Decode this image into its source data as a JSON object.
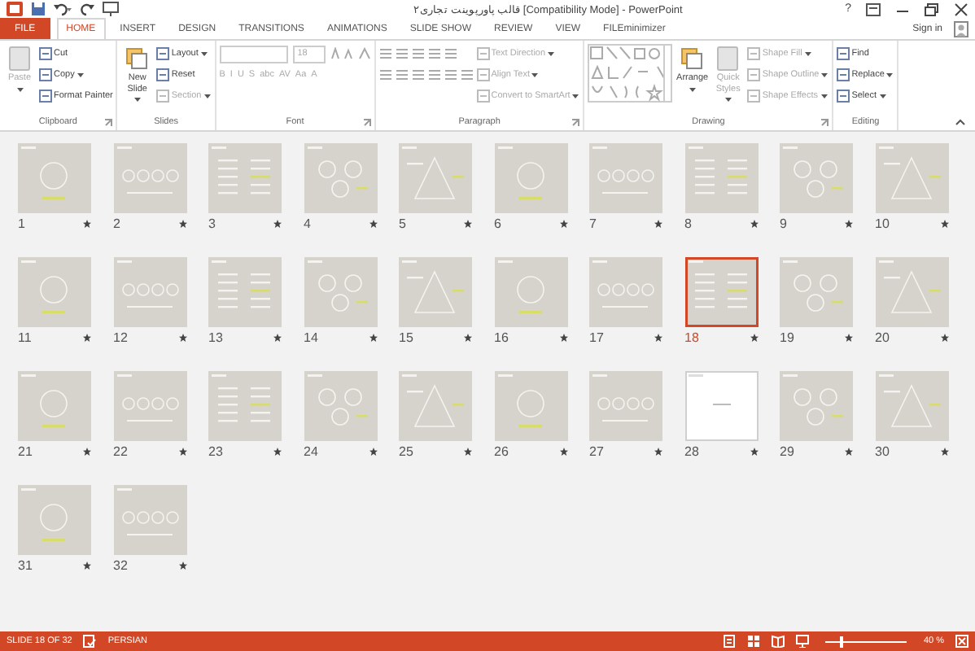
{
  "window": {
    "title": "قالب پاورپوینت تجاری۲ [Compatibility Mode] - PowerPoint",
    "help": "?"
  },
  "tabs": [
    {
      "label": "FILE",
      "kind": "file",
      "selected": false
    },
    {
      "label": "HOME",
      "kind": "tab",
      "selected": true
    },
    {
      "label": "INSERT",
      "kind": "tab",
      "selected": false
    },
    {
      "label": "DESIGN",
      "kind": "tab",
      "selected": false
    },
    {
      "label": "TRANSITIONS",
      "kind": "tab",
      "selected": false
    },
    {
      "label": "ANIMATIONS",
      "kind": "tab",
      "selected": false
    },
    {
      "label": "SLIDE SHOW",
      "kind": "tab",
      "selected": false
    },
    {
      "label": "REVIEW",
      "kind": "tab",
      "selected": false
    },
    {
      "label": "VIEW",
      "kind": "tab",
      "selected": false
    },
    {
      "label": "FILEminimizer",
      "kind": "tab",
      "selected": false
    }
  ],
  "sign_in": "Sign in",
  "ribbon": [
    {
      "label": "Clipboard",
      "launcher": true,
      "columns": [
        [
          {
            "kind": "large",
            "label": "Paste",
            "dropdown": true,
            "disabled": true
          }
        ],
        [
          {
            "kind": "small",
            "label": "Cut",
            "disabled": false
          },
          {
            "kind": "small",
            "label": "Copy",
            "dropdown": true,
            "disabled": false
          },
          {
            "kind": "small",
            "label": "Format Painter",
            "disabled": false
          }
        ]
      ]
    },
    {
      "label": "Slides",
      "launcher": false,
      "columns": [
        [
          {
            "kind": "large",
            "label": "New Slide",
            "dropdown": true,
            "disabled": false
          }
        ],
        [
          {
            "kind": "small",
            "label": "Layout",
            "dropdown": true,
            "disabled": false
          },
          {
            "kind": "small",
            "label": "Reset",
            "disabled": false
          },
          {
            "kind": "small",
            "label": "Section",
            "dropdown": true,
            "disabled": true
          }
        ]
      ]
    },
    {
      "label": "Font",
      "launcher": true,
      "columns": [
        [
          {
            "kind": "fontrow",
            "size": "18",
            "disabled": true
          },
          {
            "kind": "keys",
            "keys": [
              "B",
              "I",
              "U",
              "S",
              "abc",
              "AV",
              "Aa",
              "A"
            ],
            "disabled": true
          }
        ]
      ]
    },
    {
      "label": "Paragraph",
      "launcher": true,
      "columns": [
        [
          {
            "kind": "listrow",
            "disabled": true
          },
          {
            "kind": "alignrow",
            "disabled": true
          }
        ],
        [
          {
            "kind": "small",
            "label": "Text Direction",
            "dropdown": true,
            "disabled": true
          },
          {
            "kind": "small",
            "label": "Align Text",
            "dropdown": true,
            "disabled": true
          },
          {
            "kind": "small",
            "label": "Convert to SmartArt",
            "dropdown": true,
            "disabled": true
          }
        ]
      ]
    },
    {
      "label": "Drawing",
      "launcher": true,
      "columns": [
        [
          {
            "kind": "gallery",
            "disabled": true
          }
        ],
        [
          {
            "kind": "large",
            "label": "Arrange",
            "dropdown": true,
            "disabled": false
          }
        ],
        [
          {
            "kind": "large",
            "label": "Quick Styles",
            "dropdown": true,
            "disabled": true
          }
        ],
        [
          {
            "kind": "small",
            "label": "Shape Fill",
            "dropdown": true,
            "disabled": true
          },
          {
            "kind": "small",
            "label": "Shape Outline",
            "dropdown": true,
            "disabled": true
          },
          {
            "kind": "small",
            "label": "Shape Effects",
            "dropdown": true,
            "disabled": true
          }
        ]
      ]
    },
    {
      "label": "Editing",
      "launcher": false,
      "columns": [
        [
          {
            "kind": "small",
            "label": "Find",
            "disabled": false
          },
          {
            "kind": "small",
            "label": "Replace",
            "dropdown": true,
            "disabled": false
          },
          {
            "kind": "small",
            "label": "Select",
            "dropdown": true,
            "disabled": false
          }
        ]
      ]
    }
  ],
  "slides": [
    {
      "number": "1",
      "kind": "content",
      "selected": false,
      "animated": true
    },
    {
      "number": "2",
      "kind": "content",
      "selected": false,
      "animated": true
    },
    {
      "number": "3",
      "kind": "content",
      "selected": false,
      "animated": true
    },
    {
      "number": "4",
      "kind": "content",
      "selected": false,
      "animated": true
    },
    {
      "number": "5",
      "kind": "content",
      "selected": false,
      "animated": true
    },
    {
      "number": "6",
      "kind": "content",
      "selected": false,
      "animated": true
    },
    {
      "number": "7",
      "kind": "content",
      "selected": false,
      "animated": true
    },
    {
      "number": "8",
      "kind": "content",
      "selected": false,
      "animated": true
    },
    {
      "number": "9",
      "kind": "content",
      "selected": false,
      "animated": true
    },
    {
      "number": "10",
      "kind": "content",
      "selected": false,
      "animated": true
    },
    {
      "number": "11",
      "kind": "content",
      "selected": false,
      "animated": true
    },
    {
      "number": "12",
      "kind": "content",
      "selected": false,
      "animated": true
    },
    {
      "number": "13",
      "kind": "content",
      "selected": false,
      "animated": true
    },
    {
      "number": "14",
      "kind": "content",
      "selected": false,
      "animated": true
    },
    {
      "number": "15",
      "kind": "content",
      "selected": false,
      "animated": true
    },
    {
      "number": "16",
      "kind": "content",
      "selected": false,
      "animated": true
    },
    {
      "number": "17",
      "kind": "content",
      "selected": false,
      "animated": true
    },
    {
      "number": "18",
      "kind": "content",
      "selected": true,
      "animated": true
    },
    {
      "number": "19",
      "kind": "content",
      "selected": false,
      "animated": true
    },
    {
      "number": "20",
      "kind": "content",
      "selected": false,
      "animated": true
    },
    {
      "number": "21",
      "kind": "content",
      "selected": false,
      "animated": true
    },
    {
      "number": "22",
      "kind": "content",
      "selected": false,
      "animated": true
    },
    {
      "number": "23",
      "kind": "content",
      "selected": false,
      "animated": true
    },
    {
      "number": "24",
      "kind": "content",
      "selected": false,
      "animated": true
    },
    {
      "number": "25",
      "kind": "content",
      "selected": false,
      "animated": true
    },
    {
      "number": "26",
      "kind": "content",
      "selected": false,
      "animated": true
    },
    {
      "number": "27",
      "kind": "content",
      "selected": false,
      "animated": true
    },
    {
      "number": "28",
      "kind": "blank",
      "selected": false,
      "animated": true
    },
    {
      "number": "29",
      "kind": "content",
      "selected": false,
      "animated": true
    },
    {
      "number": "30",
      "kind": "content",
      "selected": false,
      "animated": true
    },
    {
      "number": "31",
      "kind": "content",
      "selected": false,
      "animated": true
    },
    {
      "number": "32",
      "kind": "content",
      "selected": false,
      "animated": true
    }
  ],
  "status_bar": {
    "slide": "SLIDE 18 OF 32",
    "language": "PERSIAN",
    "zoom": "40 %",
    "zoom_slider": {
      "level": 0.2
    }
  }
}
